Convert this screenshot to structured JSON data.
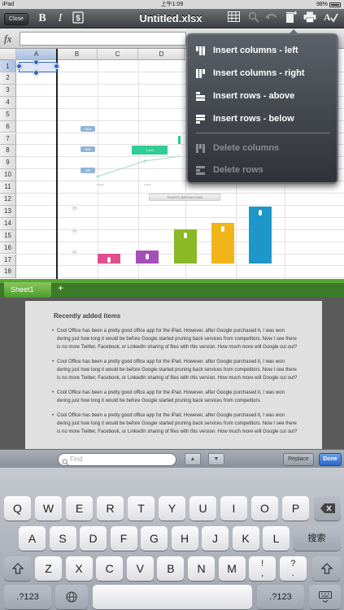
{
  "status": {
    "carrier": "iPad",
    "time": "上午1:09",
    "battery": "98%"
  },
  "toolbar": {
    "close_label": "Close",
    "bold_label": "B",
    "italic_label": "I",
    "title": "Untitled.xlsx"
  },
  "formula": {
    "fx_label": "fx",
    "value": ""
  },
  "sheet": {
    "columns": [
      "A",
      "B",
      "C",
      "D"
    ],
    "rows": [
      "1",
      "2",
      "3",
      "4",
      "5",
      "6",
      "7",
      "8",
      "9",
      "10",
      "11",
      "12",
      "13",
      "14",
      "15",
      "16",
      "17",
      "18"
    ]
  },
  "chart": {
    "title": "TRAFFIC BREAKDOWN",
    "chips": [
      "7824",
      "542",
      "506"
    ],
    "mini_label": "1,444",
    "y_ticks": [
      "7K",
      "?K",
      "?K"
    ],
    "x_ticks": [
      "1 april",
      "1 april"
    ],
    "bar_colors": [
      "#e14e8e",
      "#a64fb8",
      "#8bb826",
      "#f1b51a",
      "#1d97c9"
    ],
    "bar_values": [
      12,
      16,
      42,
      50,
      70
    ]
  },
  "menu": {
    "items": [
      {
        "label": "Insert columns - left",
        "enabled": true
      },
      {
        "label": "Insert columns - right",
        "enabled": true
      },
      {
        "label": "Insert rows - above",
        "enabled": true
      },
      {
        "label": "Insert rows - below",
        "enabled": true
      },
      {
        "label": "Delete columns",
        "enabled": false
      },
      {
        "label": "Delete rows",
        "enabled": false
      }
    ]
  },
  "tabs": {
    "sheet1": "Sheet1",
    "add": "+"
  },
  "doc": {
    "heading": "Recently added items",
    "paragraphs": [
      "Cool Office has been a pretty good office app for the iPad. However, after Google purchased it, I was won dering just how long it would be before Google started pruning back services from competitors. Now I see there is no more Twitter, Facebook, or LinkedIn sharing of files with this version. How much more will Google cut out?",
      "Cool Office has been a pretty good office app for the iPad. However, after Google purchased it, I was won dering just how long it would be before Google started pruning back services from competitors. Now I see there is no more Twitter, Facebook, or LinkedIn sharing of files with this version. How much more will Google cut out?",
      "Cool Office has been a pretty good office app for the iPad. However, after Google purchased it, I was won dering just how long it would be before Google started pruning back services from competitors.",
      "Cool Office has been a pretty good office app for the iPad. However, after Google purchased it, I was won dering just how long it would be before Google started pruning back services from competitors. Now I see there is no more Twitter, Facebook, or LinkedIn sharing of files with this version. How much more will Google cut out?"
    ]
  },
  "find": {
    "placeholder": "Find",
    "up": "▲",
    "down": "▼",
    "replace": "Replace",
    "done": "Done"
  },
  "keyboard": {
    "row1": [
      "Q",
      "W",
      "E",
      "R",
      "T",
      "Y",
      "U",
      "I",
      "O",
      "P"
    ],
    "row2": [
      "A",
      "S",
      "D",
      "F",
      "G",
      "H",
      "J",
      "K",
      "L"
    ],
    "search": "搜索",
    "row3": [
      "Z",
      "X",
      "C",
      "V",
      "B",
      "N",
      "M",
      "!\n,",
      "?\n."
    ],
    "mode": ".?123",
    "globe": "🌐"
  }
}
